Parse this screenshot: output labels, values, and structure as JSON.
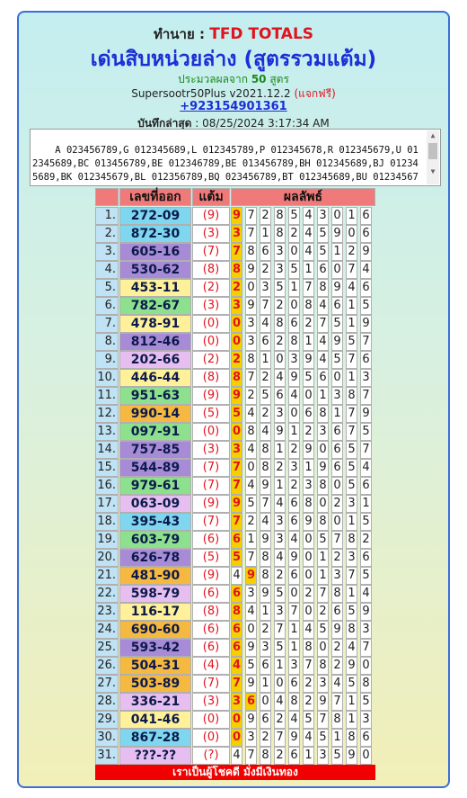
{
  "header": {
    "by_label": "ทำนาย : ",
    "brand": "TFD TOTALS",
    "title": "เด่นสิบหน่วยล่าง (สูตรรวมแต้ม)",
    "process_prefix": "ประมวลผลจาก ",
    "process_count": "50",
    "process_suffix": " สูตร",
    "software": "Supersootr50Plus v2021.12.2 ",
    "free_label": "(แจกฟรี)",
    "phone": "+923154901361",
    "saved_label": "บันทึกล่าสุด",
    "saved_value": " : 08/25/2024 3:17:34 AM"
  },
  "textbox": "A 023456789,G 012345689,L 012345789,P 012345678,R 012345679,U 012345689,BC 013456789,BE 012346789,BE 013456789,BH 012345689,BJ 012345689,BK 012345679,BL 012356789,BQ 023456789,BT 012345689,BU 012345679,CC",
  "table": {
    "headers": [
      "",
      "เลขที่ออก",
      "แต้ม",
      "ผลลัพธ์"
    ],
    "rows": [
      {
        "n": "1.",
        "result": "272-09",
        "points": "(9)",
        "digits": "9728543016",
        "hi": [
          0
        ],
        "color": "#7fd6ef"
      },
      {
        "n": "2.",
        "result": "872-30",
        "points": "(3)",
        "digits": "3718245906",
        "hi": [
          0
        ],
        "color": "#7fd6ef"
      },
      {
        "n": "3.",
        "result": "605-16",
        "points": "(7)",
        "digits": "7863045129",
        "hi": [
          0
        ],
        "color": "#a78bd6"
      },
      {
        "n": "4.",
        "result": "530-62",
        "points": "(8)",
        "digits": "8923516074",
        "hi": [
          0
        ],
        "color": "#a78bd6"
      },
      {
        "n": "5.",
        "result": "453-11",
        "points": "(2)",
        "digits": "2035178946",
        "hi": [
          0
        ],
        "color": "#fff09a"
      },
      {
        "n": "6.",
        "result": "782-67",
        "points": "(3)",
        "digits": "3972084615",
        "hi": [
          0
        ],
        "color": "#8de08d"
      },
      {
        "n": "7.",
        "result": "478-91",
        "points": "(0)",
        "digits": "0348627519",
        "hi": [
          0
        ],
        "color": "#fff09a"
      },
      {
        "n": "8.",
        "result": "812-46",
        "points": "(0)",
        "digits": "0362814957",
        "hi": [
          0
        ],
        "color": "#a78bd6"
      },
      {
        "n": "9.",
        "result": "202-66",
        "points": "(2)",
        "digits": "2810394576",
        "hi": [
          0
        ],
        "color": "#e6bff0"
      },
      {
        "n": "10.",
        "result": "446-44",
        "points": "(8)",
        "digits": "8724956013",
        "hi": [
          0
        ],
        "color": "#fff09a"
      },
      {
        "n": "11.",
        "result": "951-63",
        "points": "(9)",
        "digits": "9256401387",
        "hi": [
          0
        ],
        "color": "#8de08d"
      },
      {
        "n": "12.",
        "result": "990-14",
        "points": "(5)",
        "digits": "5423068179",
        "hi": [
          0
        ],
        "color": "#f5b942"
      },
      {
        "n": "13.",
        "result": "097-91",
        "points": "(0)",
        "digits": "0849123675",
        "hi": [
          0
        ],
        "color": "#8de08d"
      },
      {
        "n": "14.",
        "result": "757-85",
        "points": "(3)",
        "digits": "3481290657",
        "hi": [
          0
        ],
        "color": "#a78bd6"
      },
      {
        "n": "15.",
        "result": "544-89",
        "points": "(7)",
        "digits": "7082319654",
        "hi": [
          0
        ],
        "color": "#a78bd6"
      },
      {
        "n": "16.",
        "result": "979-61",
        "points": "(7)",
        "digits": "7491238056",
        "hi": [
          0
        ],
        "color": "#8de08d"
      },
      {
        "n": "17.",
        "result": "063-09",
        "points": "(9)",
        "digits": "9574680231",
        "hi": [
          0
        ],
        "color": "#e6bff0"
      },
      {
        "n": "18.",
        "result": "395-43",
        "points": "(7)",
        "digits": "7243698015",
        "hi": [
          0
        ],
        "color": "#7fd6ef"
      },
      {
        "n": "19.",
        "result": "603-79",
        "points": "(6)",
        "digits": "6193405782",
        "hi": [
          0
        ],
        "color": "#8de08d"
      },
      {
        "n": "20.",
        "result": "626-78",
        "points": "(5)",
        "digits": "5784901236",
        "hi": [
          0
        ],
        "color": "#a78bd6"
      },
      {
        "n": "21.",
        "result": "481-90",
        "points": "(9)",
        "digits": "4982601375",
        "hi": [
          1
        ],
        "color": "#f5b942"
      },
      {
        "n": "22.",
        "result": "598-79",
        "points": "(6)",
        "digits": "6395027814",
        "hi": [
          0
        ],
        "color": "#e6bff0"
      },
      {
        "n": "23.",
        "result": "116-17",
        "points": "(8)",
        "digits": "8413702659",
        "hi": [
          0
        ],
        "color": "#fff09a"
      },
      {
        "n": "24.",
        "result": "690-60",
        "points": "(6)",
        "digits": "6027145983",
        "hi": [
          0
        ],
        "color": "#f5b942"
      },
      {
        "n": "25.",
        "result": "593-42",
        "points": "(6)",
        "digits": "6935180247",
        "hi": [
          0
        ],
        "color": "#a78bd6"
      },
      {
        "n": "26.",
        "result": "504-31",
        "points": "(4)",
        "digits": "4561378290",
        "hi": [
          0
        ],
        "color": "#f5b942"
      },
      {
        "n": "27.",
        "result": "503-89",
        "points": "(7)",
        "digits": "7910623458",
        "hi": [
          0
        ],
        "color": "#f5b942"
      },
      {
        "n": "28.",
        "result": "336-21",
        "points": "(3)",
        "digits": "3604829715",
        "hi": [
          0,
          1
        ],
        "color": "#e6bff0"
      },
      {
        "n": "29.",
        "result": "041-46",
        "points": "(0)",
        "digits": "0962457813",
        "hi": [
          0
        ],
        "color": "#fff09a"
      },
      {
        "n": "30.",
        "result": "867-28",
        "points": "(0)",
        "digits": "0327945186",
        "hi": [
          0
        ],
        "color": "#7fd6ef"
      },
      {
        "n": "31.",
        "result": "???-??",
        "points": "(?)",
        "digits": "4782613590",
        "hi": [],
        "color": "#e6bff0"
      }
    ]
  },
  "footer": "เราเป็นผู้โชคดี มั่งมีเงินทอง"
}
